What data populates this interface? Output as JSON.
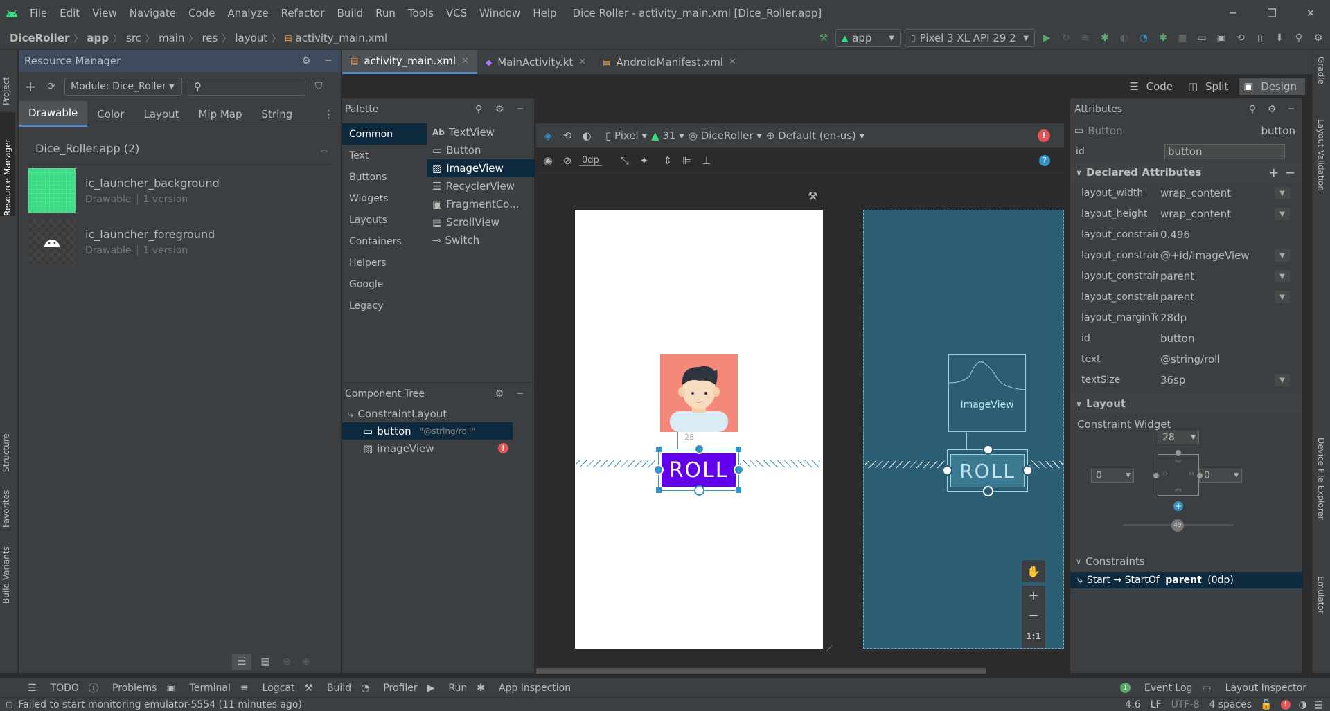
{
  "window": {
    "title": "Dice Roller - activity_main.xml [Dice_Roller.app]",
    "menu": [
      "File",
      "Edit",
      "View",
      "Navigate",
      "Code",
      "Analyze",
      "Refactor",
      "Build",
      "Run",
      "Tools",
      "VCS",
      "Window",
      "Help"
    ]
  },
  "breadcrumbs": [
    "DiceRoller",
    "app",
    "src",
    "main",
    "res",
    "layout",
    "activity_main.xml"
  ],
  "toolbar": {
    "run_config": "app",
    "device": "Pixel 3 XL API 29 2"
  },
  "left_strip": [
    "Project",
    "Resource Manager",
    "Structure",
    "Favorites",
    "Build Variants"
  ],
  "right_strip": [
    "Gradle",
    "Layout Validation",
    "Device File Explorer",
    "Emulator"
  ],
  "resource_manager": {
    "title": "Resource Manager",
    "module_select": "Module: Dice_Roller",
    "tabs": [
      "Drawable",
      "Color",
      "Layout",
      "Mip Map",
      "String"
    ],
    "group": "Dice_Roller.app (2)",
    "items": [
      {
        "name": "ic_launcher_background",
        "type": "Drawable",
        "versions": "1 version"
      },
      {
        "name": "ic_launcher_foreground",
        "type": "Drawable",
        "versions": "1 version"
      }
    ]
  },
  "editor_tabs": [
    "activity_main.xml",
    "MainActivity.kt",
    "AndroidManifest.xml"
  ],
  "view_modes": [
    "Code",
    "Split",
    "Design"
  ],
  "palette": {
    "title": "Palette",
    "categories": [
      "Common",
      "Text",
      "Buttons",
      "Widgets",
      "Layouts",
      "Containers",
      "Helpers",
      "Google",
      "Legacy"
    ],
    "items": [
      "TextView",
      "Button",
      "ImageView",
      "RecyclerView",
      "FragmentCo...",
      "ScrollView",
      "Switch"
    ]
  },
  "design_toolbar": {
    "device": "Pixel",
    "api": "31",
    "theme": "DiceRoller",
    "locale": "Default (en-us)",
    "margin": "0dp"
  },
  "component_tree": {
    "title": "Component Tree",
    "root": "ConstraintLayout",
    "children": [
      {
        "name": "button",
        "hint": "\"@string/roll\""
      },
      {
        "name": "imageView",
        "hint": ""
      }
    ]
  },
  "preview": {
    "button_text": "ROLL",
    "blueprint_button_text": "ROLL",
    "blueprint_image_label": "ImageView",
    "margin_label": "28"
  },
  "zoom_controls": [
    "+",
    "−",
    "1:1"
  ],
  "attributes": {
    "title": "Attributes",
    "widget": "Button",
    "widget_id_right": "button",
    "id_label": "id",
    "id_value": "button",
    "declared_title": "Declared Attributes",
    "declared": [
      {
        "k": "layout_width",
        "v": "wrap_content",
        "dd": true
      },
      {
        "k": "layout_height",
        "v": "wrap_content",
        "dd": true
      },
      {
        "k": "layout_constraint...",
        "v": "0.496",
        "dd": false
      },
      {
        "k": "layout_constraint...",
        "v": "@+id/imageView",
        "dd": true
      },
      {
        "k": "layout_constraint...",
        "v": "parent",
        "dd": true
      },
      {
        "k": "layout_constraint...",
        "v": "parent",
        "dd": true
      },
      {
        "k": "layout_marginTop",
        "v": "28dp",
        "dd": false
      },
      {
        "k": "id",
        "v": "button",
        "dd": false
      },
      {
        "k": "text",
        "v": "@string/roll",
        "dd": false
      },
      {
        "k": "textSize",
        "v": "36sp",
        "dd": true
      }
    ],
    "layout_title": "Layout",
    "constraint_widget": "Constraint Widget",
    "margin_top": "28",
    "margin_start": "0",
    "margin_end": "0",
    "bias": "49",
    "constraints_title": "Constraints",
    "constraint_row": {
      "prefix": "Start → StartOf ",
      "bold": "parent",
      "suffix": " (0dp)"
    }
  },
  "bottom_tools": [
    "TODO",
    "Problems",
    "Terminal",
    "Logcat",
    "Build",
    "Profiler",
    "Run",
    "App Inspection"
  ],
  "bottom_tools_right": [
    "Event Log",
    "Layout Inspector"
  ],
  "event_count": "1",
  "status": {
    "message": "Failed to start monitoring emulator-5554 (11 minutes ago)",
    "position": "4:6",
    "line_sep": "LF",
    "encoding": "UTF-8",
    "indent": "4 spaces"
  },
  "colors": {
    "accent": "#4a88c7",
    "android_green": "#3ddc84",
    "button_purple": "#6200ee",
    "blueprint": "#2b5e73",
    "error": "#e05555"
  }
}
